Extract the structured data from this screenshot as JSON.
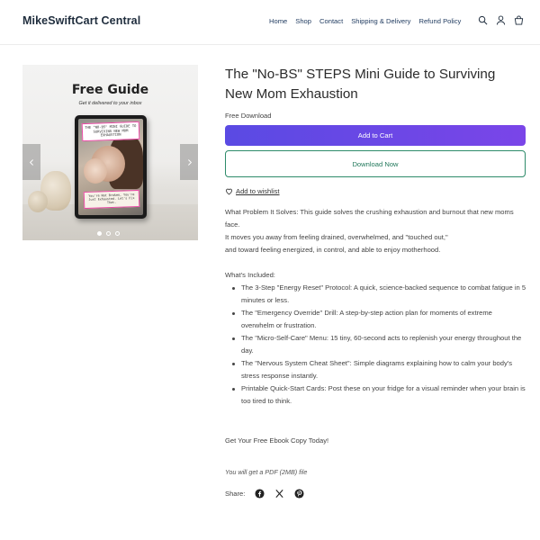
{
  "header": {
    "brand": "MikeSwiftCart Central",
    "nav": [
      "Home",
      "Shop",
      "Contact",
      "Shipping & Delivery",
      "Refund Policy"
    ],
    "icons": [
      "search-icon",
      "account-icon",
      "cart-icon"
    ]
  },
  "gallery": {
    "image_title": "Free Guide",
    "image_subtitle": "Get it delivered to your inbox",
    "cover_title": "The \"No-BS\" Mini Guide to Surviving New Mom Exhaustion",
    "cover_footer": "You're Not Broken, You're Just Exhausted. Let's Fix That.",
    "slide_count": 3,
    "active_slide": 1
  },
  "product": {
    "title": "The \"No-BS\" STEPS Mini Guide to Surviving New Mom Exhaustion",
    "price_label": "Free Download",
    "add_to_cart": "Add to Cart",
    "download_now": "Download Now",
    "wishlist": "Add to wishlist"
  },
  "description": {
    "intro_1": "What Problem It Solves: This guide solves the crushing exhaustion and burnout that new moms face.",
    "intro_2": "It moves you away from feeling drained, overwhelmed, and \"touched out,\"",
    "intro_3": "and toward feeling energized, in control, and able to enjoy motherhood.",
    "included_heading": "What's Included:",
    "items": [
      "The 3-Step \"Energy Reset\" Protocol: A quick, science-backed sequence to combat fatigue in 5 minutes or less.",
      "The \"Emergency Override\" Drill: A step-by-step action plan for moments of extreme overwhelm or frustration.",
      "The \"Micro-Self-Care\" Menu: 15 tiny, 60-second acts to replenish your energy throughout the day.",
      "The \"Nervous System Cheat Sheet\": Simple diagrams explaining how to calm your body's stress response instantly.",
      "Printable Quick-Start Cards: Post these on your fridge for a visual reminder when your brain is too tired to think."
    ],
    "cta": "Get Your Free Ebook Copy Today!",
    "file_note": "You will get a PDF (2MB) file"
  },
  "share": {
    "label": "Share:",
    "icons": [
      "facebook-icon",
      "x-icon",
      "pinterest-icon"
    ]
  },
  "colors": {
    "cart_button": "#5a4ae3",
    "download_border": "#2e8b6a",
    "brand_text": "#1f2d3d",
    "nav_text": "#1f3a5f"
  }
}
